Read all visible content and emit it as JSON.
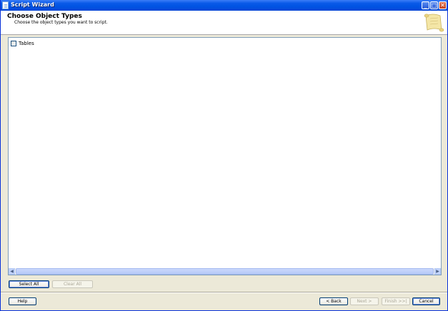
{
  "window": {
    "title": "Script Wizard"
  },
  "header": {
    "title": "Choose Object Types",
    "subtitle": "Choose the object types you want to script."
  },
  "list": {
    "items": [
      {
        "label": "Tables",
        "checked": false
      }
    ]
  },
  "buttons": {
    "select_all": "Select All",
    "clear_all": "Clear All",
    "help": "Help",
    "back": "< Back",
    "next": "Next >",
    "finish": "Finish >>|",
    "cancel": "Cancel"
  },
  "caption_buttons": {
    "minimize": "_",
    "maximize": "□",
    "close": "✕"
  }
}
